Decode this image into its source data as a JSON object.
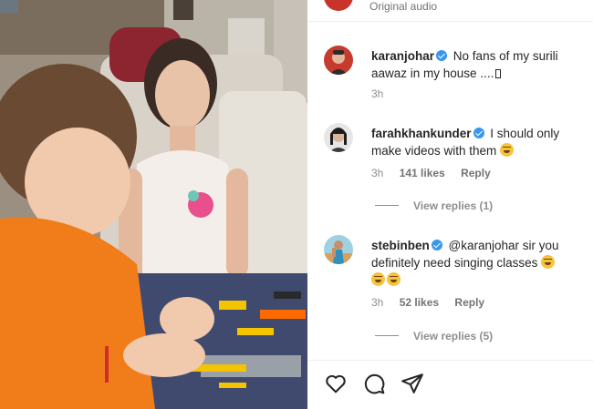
{
  "post": {
    "audio_label": "Original audio"
  },
  "comments": [
    {
      "username": "karanjohar",
      "text": "No fans of my surili aawaz in my house ....",
      "time": "3h"
    },
    {
      "username": "farahkhankunder",
      "text": "I should only make videos with them",
      "time": "3h",
      "likes": "141 likes",
      "reply_label": "Reply",
      "view_replies": "View replies (1)"
    },
    {
      "username": "stebinben",
      "text": "@karanjohar sir you definitely need singing classes",
      "time": "3h",
      "likes": "52 likes",
      "reply_label": "Reply",
      "view_replies": "View replies (5)"
    }
  ],
  "actions": [
    "heart-icon",
    "comment-icon",
    "share-icon"
  ],
  "colors": {
    "verified": "#3897f0",
    "secondary_text": "#8e8e8e"
  }
}
